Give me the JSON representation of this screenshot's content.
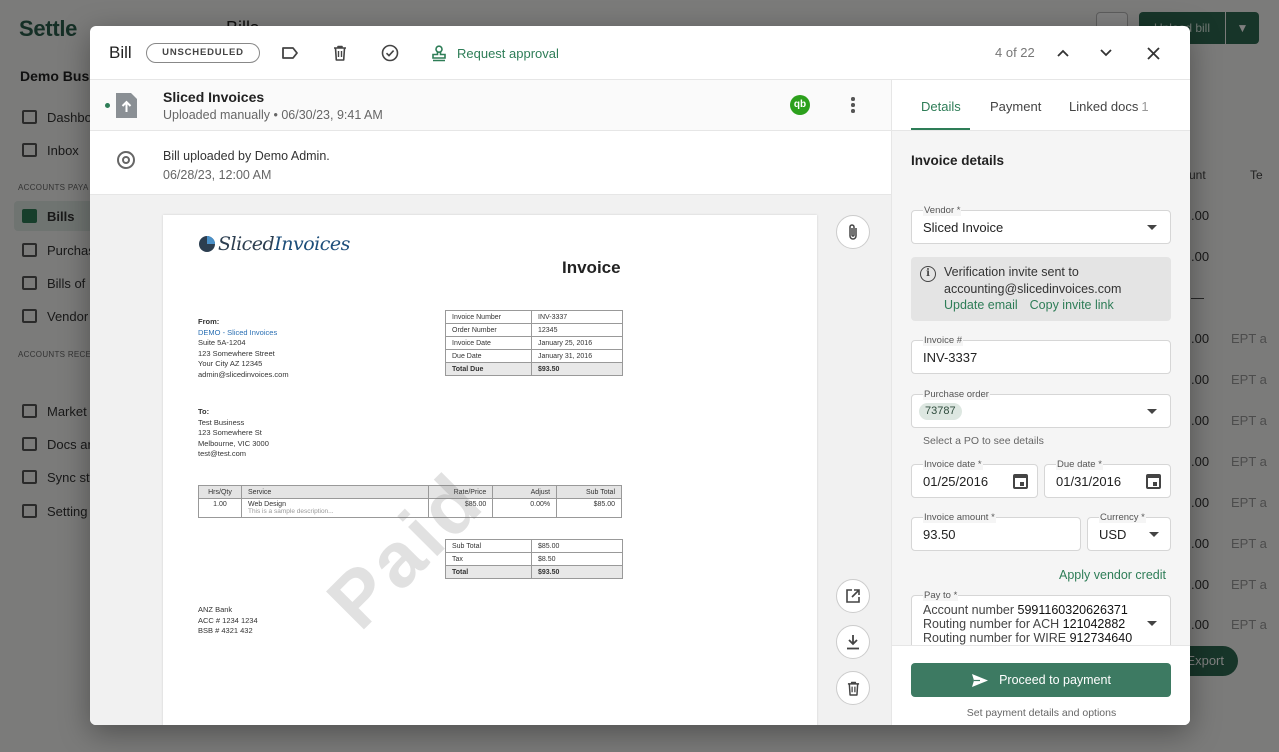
{
  "background": {
    "logo": "Settle",
    "company": "Demo Busi",
    "page_title": "Bills",
    "upload_button": "Upload bill",
    "section_payable": "ACCOUNTS PAYA",
    "section_receivable": "ACCOUNTS RECE",
    "nav": [
      "Dashbo",
      "Inbox",
      "Bills",
      "Purchas",
      "Bills of",
      "Vendor",
      "Market",
      "Docs ar",
      "Sync st",
      "Setting"
    ],
    "col_amount": "unt",
    "col_other": "Te",
    "amounts": [
      ".00",
      ".00",
      "—",
      ".00",
      ".00",
      ".00",
      ".00",
      ".00",
      ".00",
      ".00",
      ".00",
      ".00"
    ],
    "ept": [
      "EPT a",
      "EPT a",
      "EPT a",
      "EPT a",
      "EPT a",
      "EPT a",
      "EPT a",
      "EPT a",
      "EPT a"
    ],
    "export": "Export"
  },
  "header": {
    "title": "Bill",
    "status": "UNSCHEDULED",
    "request_approval": "Request approval",
    "counter": "4 of 22"
  },
  "file": {
    "name": "Sliced Invoices",
    "meta": "Uploaded manually • 06/30/23, 9:41 AM",
    "qb": "qb"
  },
  "activity": {
    "text": "Bill uploaded by Demo Admin.",
    "date": "06/28/23, 12:00 AM"
  },
  "invoice_doc": {
    "logo_a": "Sliced",
    "logo_b": "Invoices",
    "heading": "Invoice",
    "from_label": "From:",
    "from_company": "DEMO - Sliced Invoices",
    "from_lines": [
      "Suite 5A-1204",
      "123 Somewhere Street",
      "Your City AZ 12345",
      "admin@slicedinvoices.com"
    ],
    "to_label": "To:",
    "to_lines": [
      "Test Business",
      "123 Somewhere St",
      "Melbourne, VIC 3000",
      "test@test.com"
    ],
    "meta": [
      [
        "Invoice Number",
        "INV-3337"
      ],
      [
        "Order Number",
        "12345"
      ],
      [
        "Invoice Date",
        "January 25, 2016"
      ],
      [
        "Due Date",
        "January 31, 2016"
      ],
      [
        "Total Due",
        "$93.50"
      ]
    ],
    "items_headers": [
      "Hrs/Qty",
      "Service",
      "Rate/Price",
      "Adjust",
      "Sub Total"
    ],
    "item": {
      "qty": "1.00",
      "service": "Web Design",
      "desc": "This is a sample description...",
      "rate": "$85.00",
      "adjust": "0.00%",
      "subtotal": "$85.00"
    },
    "totals": [
      [
        "Sub Total",
        "$85.00"
      ],
      [
        "Tax",
        "$8.50"
      ],
      [
        "Total",
        "$93.50"
      ]
    ],
    "bank_lines": [
      "ANZ Bank",
      "ACC # 1234 1234",
      "BSB # 4321 432"
    ],
    "stamp": "Paid"
  },
  "tabs": {
    "details": "Details",
    "payment": "Payment",
    "linked_docs": "Linked docs",
    "linked_count": "1"
  },
  "details": {
    "title": "Invoice details",
    "vendor_label": "Vendor *",
    "vendor_value": "Sliced Invoice",
    "info_text": "Verification invite sent to accounting@slicedinvoices.com",
    "update_email": "Update email",
    "copy_invite": "Copy invite link",
    "invoice_no_label": "Invoice #",
    "invoice_no_value": "INV-3337",
    "po_label": "Purchase order",
    "po_chip": "73787",
    "po_helper": "Select a PO to see details",
    "invoice_date_label": "Invoice date *",
    "invoice_date_value": "01/25/2016",
    "due_date_label": "Due date *",
    "due_date_value": "01/31/2016",
    "amount_label": "Invoice amount *",
    "amount_value": "93.50",
    "currency_label": "Currency *",
    "currency_value": "USD",
    "vendor_credit": "Apply vendor credit",
    "payto_label": "Pay to *",
    "account_label": "Account number",
    "account_value": "5991160320626371",
    "ach_label": "Routing number for ACH",
    "ach_value": "121042882",
    "wire_label": "Routing number for WIRE",
    "wire_value": "912734640"
  },
  "footer": {
    "proceed": "Proceed to payment",
    "note": "Set payment details and options"
  },
  "colors": {
    "brand_green": "#2e7d57",
    "button_green": "#3d7a62",
    "qb_green": "#2ca01c"
  }
}
